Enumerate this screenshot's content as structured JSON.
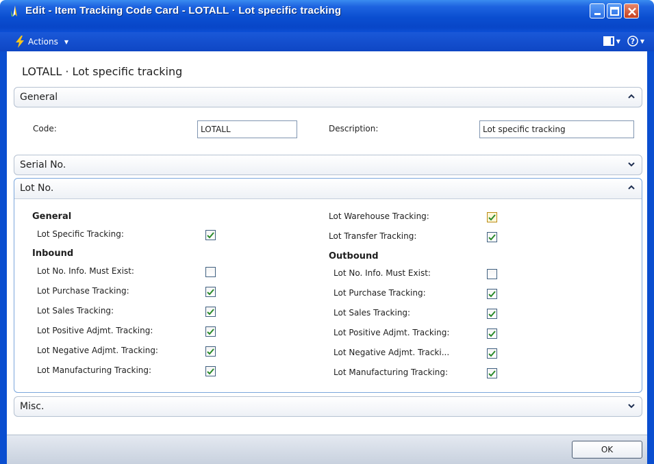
{
  "window": {
    "title": "Edit - Item Tracking Code Card - LOTALL · Lot specific tracking"
  },
  "toolbar": {
    "actions_label": "Actions"
  },
  "page": {
    "title": "LOTALL · Lot specific tracking"
  },
  "tabs": {
    "general": {
      "label": "General",
      "code_label": "Code:",
      "code_value": "LOTALL",
      "description_label": "Description:",
      "description_value": "Lot specific tracking"
    },
    "serial": {
      "label": "Serial No."
    },
    "lot": {
      "label": "Lot No.",
      "left_general_head": "General",
      "lot_specific_label": "Lot Specific Tracking:",
      "inbound_head": "Inbound",
      "inbound": [
        {
          "label": "Lot No. Info. Must Exist:",
          "checked": false
        },
        {
          "label": "Lot Purchase Tracking:",
          "checked": true
        },
        {
          "label": "Lot Sales Tracking:",
          "checked": true
        },
        {
          "label": "Lot Positive Adjmt. Tracking:",
          "checked": true
        },
        {
          "label": "Lot Negative Adjmt. Tracking:",
          "checked": true
        },
        {
          "label": "Lot Manufacturing Tracking:",
          "checked": true
        }
      ],
      "warehouse_label": "Lot Warehouse Tracking:",
      "transfer_label": "Lot Transfer Tracking:",
      "outbound_head": "Outbound",
      "outbound": [
        {
          "label": "Lot No. Info. Must Exist:",
          "checked": false
        },
        {
          "label": "Lot Purchase Tracking:",
          "checked": true
        },
        {
          "label": "Lot Sales Tracking:",
          "checked": true
        },
        {
          "label": "Lot Positive Adjmt. Tracking:",
          "checked": true
        },
        {
          "label": "Lot Negative Adjmt. Tracki...",
          "checked": true
        },
        {
          "label": "Lot Manufacturing Tracking:",
          "checked": true
        }
      ]
    },
    "misc": {
      "label": "Misc."
    }
  },
  "footer": {
    "ok_label": "OK"
  },
  "colors": {
    "titlebar": "#0a4ed0",
    "check": "#2a8a2a",
    "focused_border": "#7aa6dc"
  }
}
